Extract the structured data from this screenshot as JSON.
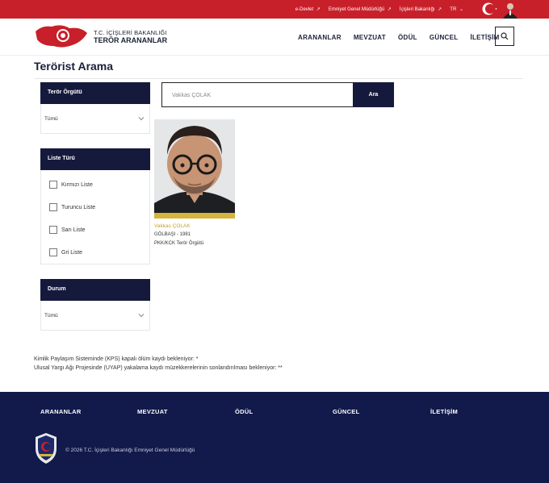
{
  "topbar": {
    "links": [
      "e-Devlet",
      "Emniyet Genel Müdürlüğü",
      "İçişleri Bakanlığı"
    ],
    "lang": "TR",
    "color": "#c8202a"
  },
  "header": {
    "logo_line1": "T.C. İÇİŞLERİ BAKANLIĞI",
    "logo_line2": "TERÖR ARANANLAR",
    "nav": [
      "ARANANLAR",
      "MEVZUAT",
      "ÖDÜL",
      "GÜNCEL",
      "İLETİŞİM"
    ],
    "search_icon": "search-icon"
  },
  "page": {
    "title": "Terörist Arama"
  },
  "filters": {
    "org": {
      "label": "Terör Örgütü",
      "value": "Tümü"
    },
    "list": {
      "label": "Liste Türü",
      "options": [
        "Kırmızı Liste",
        "Turuncu Liste",
        "Sarı Liste",
        "Gri Liste"
      ]
    },
    "status": {
      "label": "Durum",
      "value": "Tümü"
    }
  },
  "search": {
    "placeholder": "Vakkas ÇOLAK",
    "button": "Ara"
  },
  "result": {
    "name": "Vakkas ÇOLAK",
    "birth": "GÖLBAŞI - 1981",
    "org": "PKK/KCK Terör Örgütü",
    "list_color": "#d4b43a"
  },
  "notes": {
    "line1": "Kimlik Paylaşım Sisteminde (KPS) kapalı ölüm kaydı bekleniyor: *",
    "line2": "Ulusal Yargı Ağı Projesinde (UYAP) yakalama kaydı müzekkerelerinin sonlandırılması bekleniyor: **"
  },
  "footer": {
    "nav": [
      "ARANANLAR",
      "MEVZUAT",
      "ÖDÜL",
      "GÜNCEL",
      "İLETİŞİM"
    ],
    "copyright": "© 2026 T.C. İçişleri Bakanlığı Emniyet Genel Müdürlüğü",
    "bg": "#111a4a"
  }
}
